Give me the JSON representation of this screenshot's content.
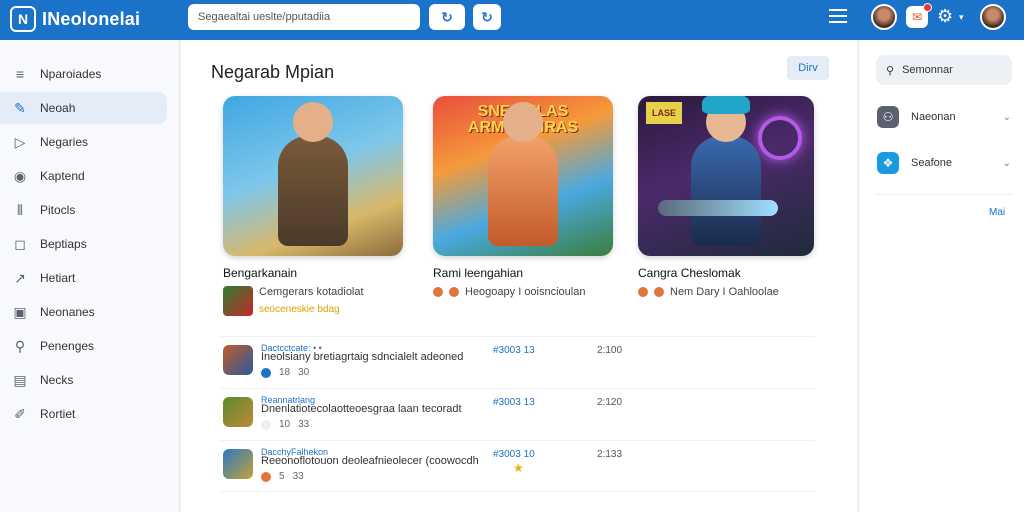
{
  "app": {
    "logo_mark": "N",
    "title": "INeolonelai"
  },
  "search": {
    "value": "Segaealtai ueslte/pputadiia"
  },
  "toolbar": {
    "btn_a_icon": "↻",
    "btn_b_icon": "↻"
  },
  "sidebar": {
    "items": [
      {
        "label": "Nparoiades",
        "icon": "list-icon",
        "glyph": "≡"
      },
      {
        "label": "Neoah",
        "icon": "pen-icon",
        "glyph": "✎"
      },
      {
        "label": "Negaries",
        "icon": "play-icon",
        "glyph": "▷"
      },
      {
        "label": "Kaptend",
        "icon": "circle-icon",
        "glyph": "◉"
      },
      {
        "label": "Pitocls",
        "icon": "bars-icon",
        "glyph": "⫴"
      },
      {
        "label": "Beptiaps",
        "icon": "square-icon",
        "glyph": "◻"
      },
      {
        "label": "Hetiart",
        "icon": "trend-icon",
        "glyph": "↗"
      },
      {
        "label": "Neonanes",
        "icon": "box-icon",
        "glyph": "▣"
      },
      {
        "label": "Penenges",
        "icon": "search-icon",
        "glyph": "⚲"
      },
      {
        "label": "Necks",
        "icon": "chat-icon",
        "glyph": "▤"
      },
      {
        "label": "Rortiet",
        "icon": "pencil-icon",
        "glyph": "✐"
      }
    ]
  },
  "main": {
    "title": "Negarab Mpian",
    "dev_button": "Dirv",
    "cards": [
      {
        "title": "Bengarkanain",
        "meta": "Cemgerars kotadiolat",
        "meta2": "seoceneskie bdag"
      },
      {
        "title": "Rami leengahian",
        "meta": "Heogoapy I ooisncioulan",
        "banner": "SNESEILAS ARMINEMRAS"
      },
      {
        "title": "Cangra Cheslomak",
        "meta": "Nem Dary I Oahloolae",
        "logo": "LASE"
      }
    ],
    "list": [
      {
        "title": "Dactcctcate: • •",
        "desc": "Ineolsiany bretiagrtaig sdncialelt adeoned",
        "m1": "18",
        "m2": "30",
        "tag": "#3003 13",
        "time": "2:100"
      },
      {
        "title": "Reannatrlang",
        "desc": "Dnenlatiotecolaotteoesgraa laan tecoradt",
        "m1": "10",
        "m2": "33",
        "tag": "#3003 13",
        "time": "2:120"
      },
      {
        "title": "DacchyFalhekon",
        "desc": "Reeonoflotouon deoleafnieolecer (coowocdh",
        "m1": "5",
        "m2": "33",
        "tag": "#3003 10",
        "star": "★",
        "time": "2:133"
      }
    ]
  },
  "right": {
    "search_label": "Semonnar",
    "items": [
      {
        "label": "Naeonan"
      },
      {
        "label": "Seafone"
      }
    ],
    "more": "Mai"
  },
  "colors": {
    "brand": "#1a73c9",
    "accent_star": "#e8b400",
    "notification": "#e53935"
  }
}
